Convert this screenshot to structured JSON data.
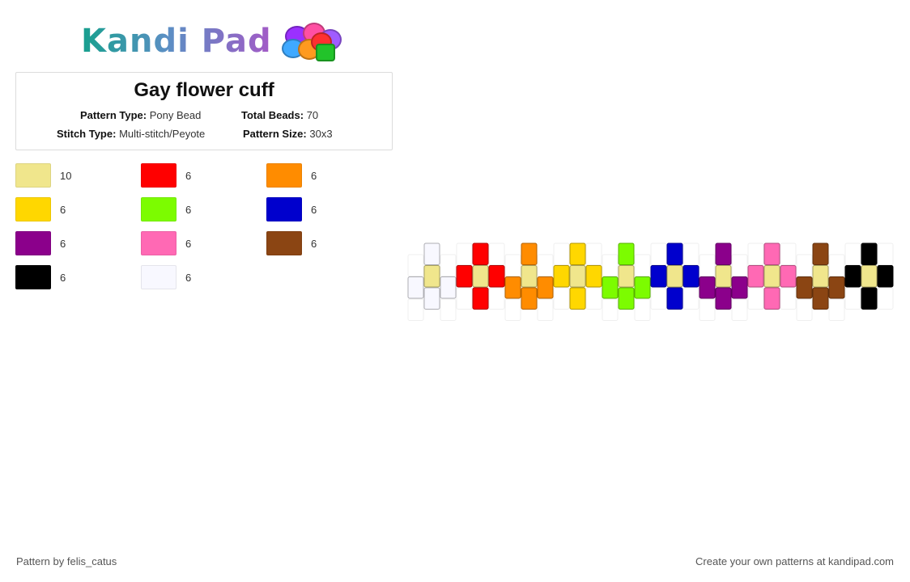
{
  "logo": {
    "text": "Kandi Pad"
  },
  "pattern": {
    "title": "Gay flower cuff",
    "pattern_type_label": "Pattern Type:",
    "pattern_type": "Pony Bead",
    "total_beads_label": "Total Beads:",
    "total_beads": "70",
    "stitch_type_label": "Stitch Type:",
    "stitch_type": "Multi-stitch/Peyote",
    "pattern_size_label": "Pattern Size:",
    "pattern_size": "30x3"
  },
  "colors": [
    {
      "hex": "#f0e68c",
      "count": "10"
    },
    {
      "hex": "#ff0000",
      "count": "6"
    },
    {
      "hex": "#ff8c00",
      "count": "6"
    },
    {
      "hex": "#ffd700",
      "count": "6"
    },
    {
      "hex": "#7cfc00",
      "count": "6"
    },
    {
      "hex": "#0000cd",
      "count": "6"
    },
    {
      "hex": "#8b008b",
      "count": "6"
    },
    {
      "hex": "#ff69b4",
      "count": "6"
    },
    {
      "hex": "#8b4513",
      "count": "6"
    },
    {
      "hex": "#000000",
      "count": "6"
    },
    {
      "hex": "#f8f8ff",
      "count": "6"
    }
  ],
  "flowers": [
    {
      "petal": "#f8f8ff",
      "center": "#f0e68c"
    },
    {
      "petal": "#ff0000",
      "center": "#f0e68c"
    },
    {
      "petal": "#ff8c00",
      "center": "#f0e68c"
    },
    {
      "petal": "#ffd700",
      "center": "#f0e68c"
    },
    {
      "petal": "#7cfc00",
      "center": "#f0e68c"
    },
    {
      "petal": "#0000cd",
      "center": "#f0e68c"
    },
    {
      "petal": "#8b008b",
      "center": "#f0e68c"
    },
    {
      "petal": "#ff69b4",
      "center": "#f0e68c"
    },
    {
      "petal": "#8b4513",
      "center": "#f0e68c"
    },
    {
      "petal": "#000000",
      "center": "#f0e68c"
    }
  ],
  "footer": {
    "author": "Pattern by felis_catus",
    "promo": "Create your own patterns at kandipad.com"
  }
}
